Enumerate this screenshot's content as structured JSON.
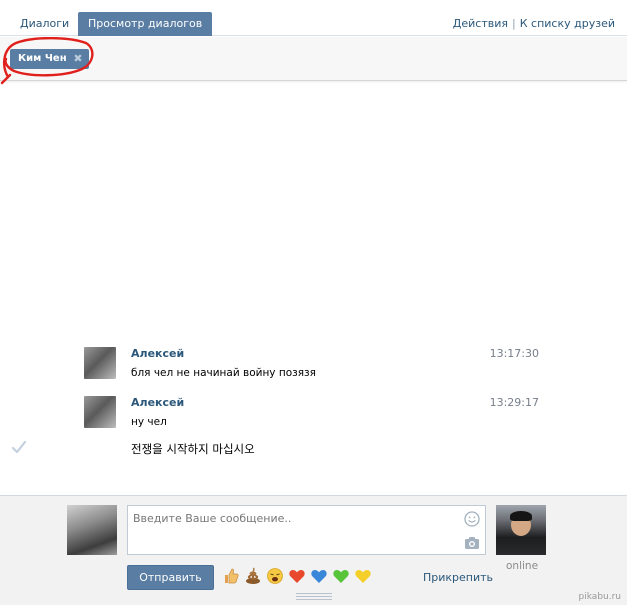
{
  "tabs": {
    "dialogs": "Диалоги",
    "view": "Просмотр диалогов"
  },
  "actions": {
    "act": "Действия",
    "separator": "|",
    "friends": "К списку друзей"
  },
  "peer_chip": {
    "name": "Ким Чен",
    "close_glyph": "✖"
  },
  "messages": [
    {
      "author": "Алексей",
      "time": "13:17:30",
      "text": "бля чел не начинай войну позязя"
    },
    {
      "author": "Алексей",
      "time": "13:29:17",
      "text": "ну чел"
    }
  ],
  "outgoing": {
    "text": "전쟁을 시작하지 마십시오"
  },
  "composer": {
    "placeholder": "Введите Ваше сообщение..",
    "send": "Отправить",
    "attach": "Прикрепить",
    "status": "online",
    "emoji": [
      "thumbs-up-icon",
      "poop-icon",
      "weary-face-icon",
      "red-heart-icon",
      "blue-heart-icon",
      "green-heart-icon",
      "yellow-heart-icon"
    ]
  },
  "watermark": "pikabu.ru",
  "colors": {
    "accent": "#597da3",
    "link": "#2b587a",
    "annotation": "#e0201c"
  }
}
